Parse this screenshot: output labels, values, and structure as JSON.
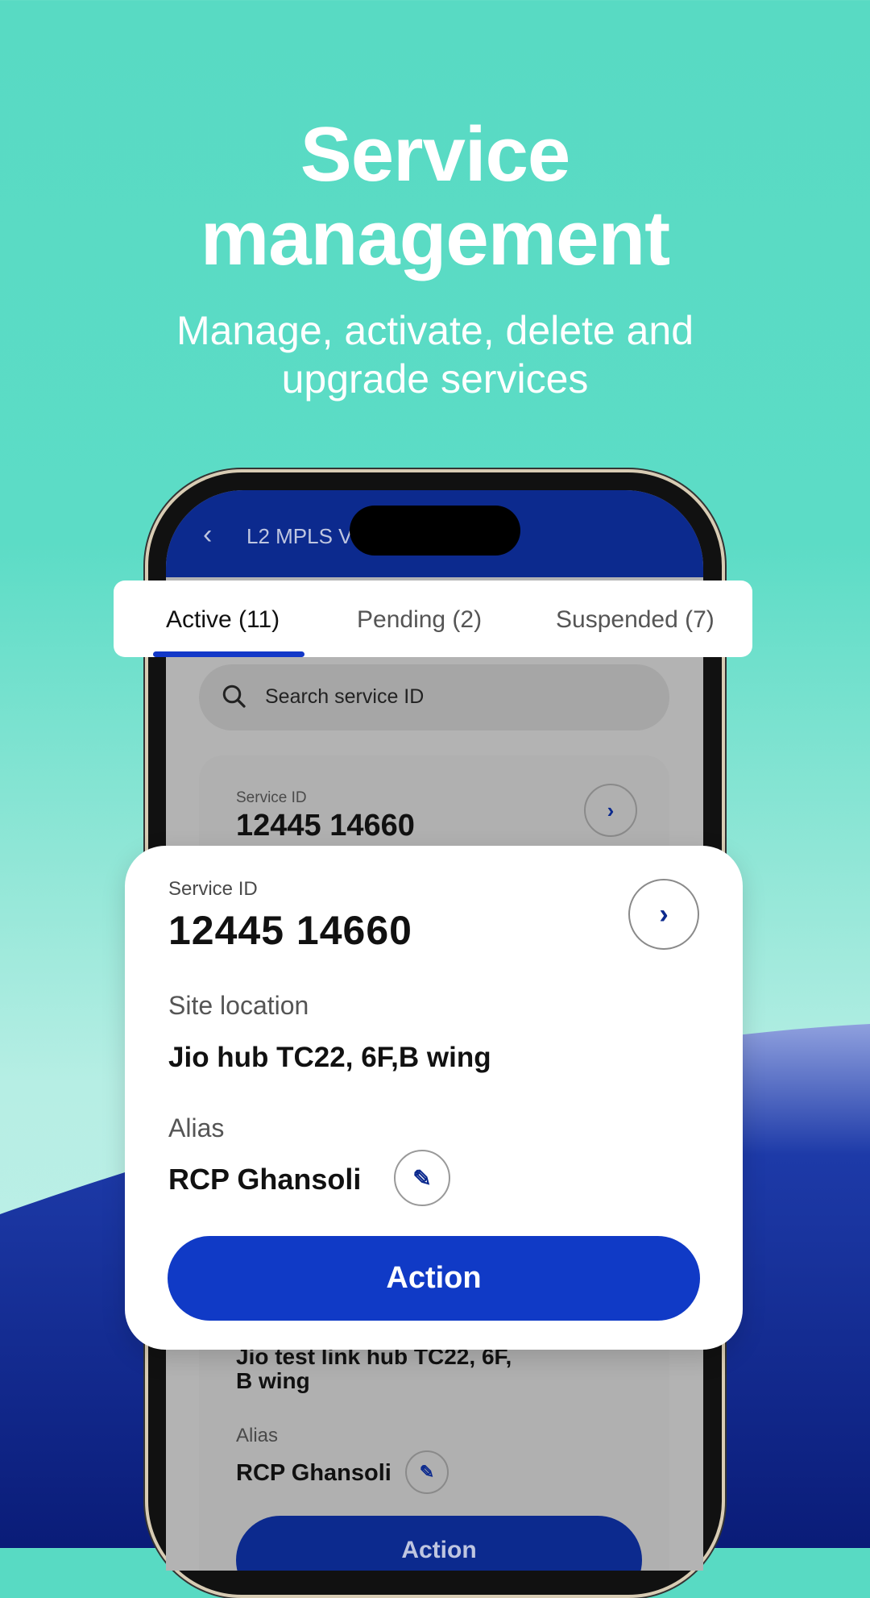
{
  "hero": {
    "title_line1": "Service",
    "title_line2": "management",
    "subtitle_line1": "Manage, activate, delete and",
    "subtitle_line2": "upgrade services"
  },
  "app": {
    "header_title": "L2 MPLS V",
    "back_icon": "chevron-left-icon",
    "tabs": [
      {
        "label": "Active (11)",
        "selected": true
      },
      {
        "label": "Pending (2)",
        "selected": false
      },
      {
        "label": "Suspended (7)",
        "selected": false
      }
    ],
    "search_placeholder": "Search service ID",
    "background_card": {
      "service_id_label": "Service ID",
      "service_id": "12445 14660",
      "site_location_partial": "Jio test link hub TC22, 6F,",
      "site_location_line2": "B wing",
      "alias_label": "Alias",
      "alias": "RCP Ghansoli",
      "action_label": "Action"
    },
    "card": {
      "service_id_label": "Service ID",
      "service_id": "12445 14660",
      "site_location_label": "Site location",
      "site_location": "Jio hub TC22, 6F,B wing",
      "alias_label": "Alias",
      "alias": "RCP Ghansoli",
      "action_label": "Action"
    }
  },
  "colors": {
    "background_teal": "#58dac3",
    "wave_blue": "#0a1f7f",
    "accent": "#103ac6",
    "header": "#0c2a8e"
  }
}
